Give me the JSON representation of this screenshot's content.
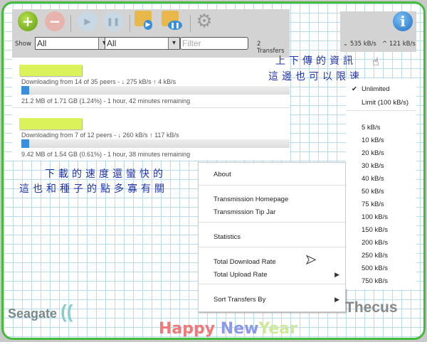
{
  "toolbar": {
    "show_label": "Show",
    "filter1": "All",
    "filter2": "All",
    "filter_placeholder": "Filter",
    "transfer_count": "2 Transfers",
    "download_rate": "535 kB/s",
    "upload_rate": "121 kB/s"
  },
  "torrents": [
    {
      "peers": "Downloading from 14 of 35 peers - ↓ 275 kB/s ↑ 4 kB/s",
      "progress_text": "21.2 MB of 1.71 GB (1.24%) - 1 hour, 42 minutes remaining",
      "progress": 1.24
    },
    {
      "peers": "Downloading from 7 of 12 peers - ↓ 260 kB/s ↑ 117 kB/s",
      "progress_text": "9.42 MB of 1.54 GB (0.61%) - 1 hour, 38 minutes remaining",
      "progress": 0.61
    }
  ],
  "menu": {
    "about": "About",
    "homepage": "Transmission Homepage",
    "tipjar": "Transmission Tip Jar",
    "statistics": "Statistics",
    "download_rate": "Total Download Rate",
    "upload_rate": "Total Upload Rate",
    "sort": "Sort Transfers By"
  },
  "submenu": {
    "checked": "✔",
    "unlimited": "Unlimited",
    "limit": "Limit (100 kB/s)",
    "rates": [
      "5 kB/s",
      "10 kB/s",
      "20 kB/s",
      "30 kB/s",
      "40 kB/s",
      "50 kB/s",
      "75 kB/s",
      "100 kB/s",
      "150 kB/s",
      "200 kB/s",
      "250 kB/s",
      "500 kB/s",
      "750 kB/s"
    ]
  },
  "annotations": {
    "a1": "上下傳的資訊",
    "a2": "這邊也可以限速",
    "b1": "下載的速度還蠻快的",
    "b2": "這也和種子的點多寡有關"
  },
  "logos": {
    "seagate": "Seagate",
    "thecus": "Thecus",
    "happy": "Happy",
    "new": "New",
    "year": "Year"
  },
  "colors": {
    "accent": "#3a8fdd",
    "border": "#44bb3a"
  }
}
